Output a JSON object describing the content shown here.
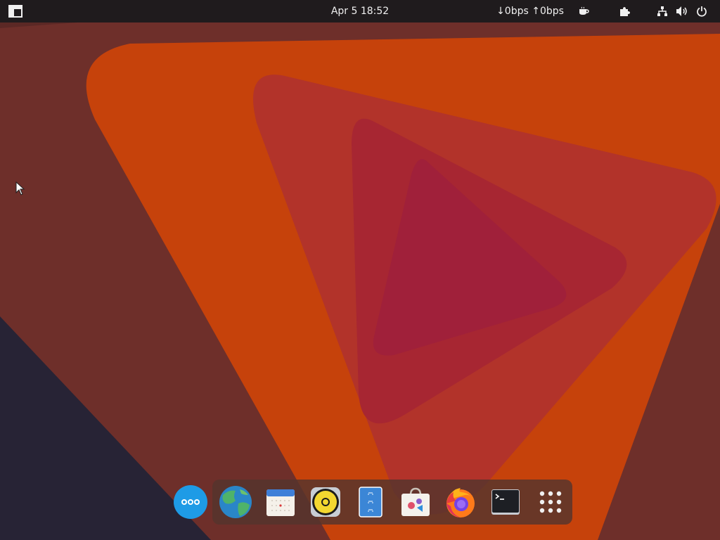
{
  "topbar": {
    "activities_icon": "activities-layout-icon",
    "clock": "Apr 5  18:52",
    "network_speed": "↓0bps ↑0bps",
    "tray_icons": [
      "caffeine-icon",
      "extensions-icon",
      "network-icon",
      "volume-icon",
      "power-icon"
    ]
  },
  "dock": {
    "apps": [
      {
        "name": "more-apps",
        "icon": "ellipsis-icon"
      },
      {
        "name": "web-browser",
        "icon": "globe-icon"
      },
      {
        "name": "calendar",
        "icon": "calendar-icon"
      },
      {
        "name": "music-player",
        "icon": "speaker-icon"
      },
      {
        "name": "file-manager",
        "icon": "file-cabinet-icon"
      },
      {
        "name": "software-store",
        "icon": "shopping-bag-icon"
      },
      {
        "name": "firefox",
        "icon": "firefox-icon"
      },
      {
        "name": "terminal",
        "icon": "terminal-icon"
      },
      {
        "name": "show-applications",
        "icon": "app-grid-icon"
      }
    ]
  },
  "colors": {
    "wallpaper_base": "#6e2f2a",
    "wallpaper_orange": "#c6420b",
    "wallpaper_red": "#b2332a",
    "wallpaper_crimson": "#a72632",
    "wallpaper_center": "#a0203a",
    "wallpaper_dark": "#272335",
    "topbar": "#1f1b1d",
    "dock": "#54342d"
  }
}
